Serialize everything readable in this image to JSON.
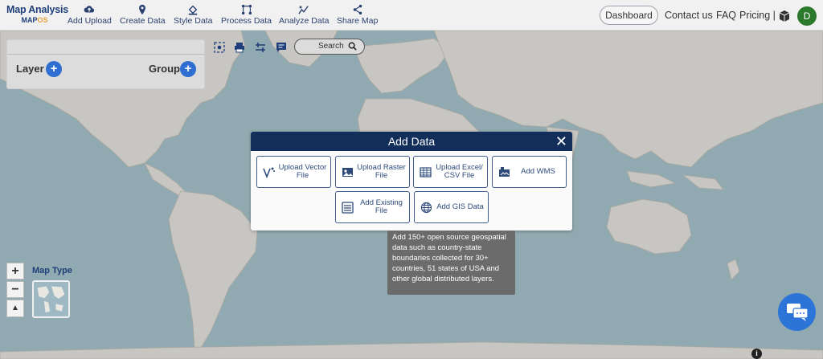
{
  "brand": {
    "title": "Map Analysis",
    "sub_prefix": "MAP",
    "sub_suffix": "OS"
  },
  "nav": {
    "items": [
      {
        "label": "Add Upload",
        "icon": "cloud-upload-icon"
      },
      {
        "label": "Create Data",
        "icon": "map-pin-icon"
      },
      {
        "label": "Style Data",
        "icon": "paint-bucket-icon"
      },
      {
        "label": "Process Data",
        "icon": "process-icon"
      },
      {
        "label": "Analyze Data",
        "icon": "analyze-icon"
      },
      {
        "label": "Share Map",
        "icon": "share-icon"
      }
    ],
    "dashboard": "Dashboard",
    "contact": "Contact us",
    "faq": "FAQ",
    "pricing": "Pricing |",
    "avatar_initial": "D"
  },
  "layer_panel": {
    "layer_label": "Layer",
    "group_label": "Group"
  },
  "toolbar": {
    "search_label": "Search"
  },
  "modal": {
    "title": "Add Data",
    "close": "✕",
    "options": [
      {
        "label": "Upload Vector File",
        "icon": "vector-icon"
      },
      {
        "label": "Upload Raster File",
        "icon": "raster-image-icon"
      },
      {
        "label": "Upload Excel/ CSV File",
        "icon": "spreadsheet-icon"
      },
      {
        "label": "Add WMS",
        "icon": "wms-icon"
      },
      {
        "label": "Add Existing File",
        "icon": "existing-file-icon"
      },
      {
        "label": "Add GIS Data",
        "icon": "globe-icon"
      }
    ]
  },
  "tooltip": {
    "text": "Add 150+ open source geospatial data such as country-state boundaries collected for 30+ countries, 51 states of USA and other global distributed layers."
  },
  "map_controls": {
    "zoom_in": "+",
    "zoom_out": "−",
    "compass": "▲",
    "map_type_label": "Map Type"
  },
  "info_badge": "i",
  "colors": {
    "navy": "#122f5c",
    "accent_blue": "#2f6fd1",
    "ocean": "#a9c6cf",
    "land": "#e9e7e2"
  }
}
